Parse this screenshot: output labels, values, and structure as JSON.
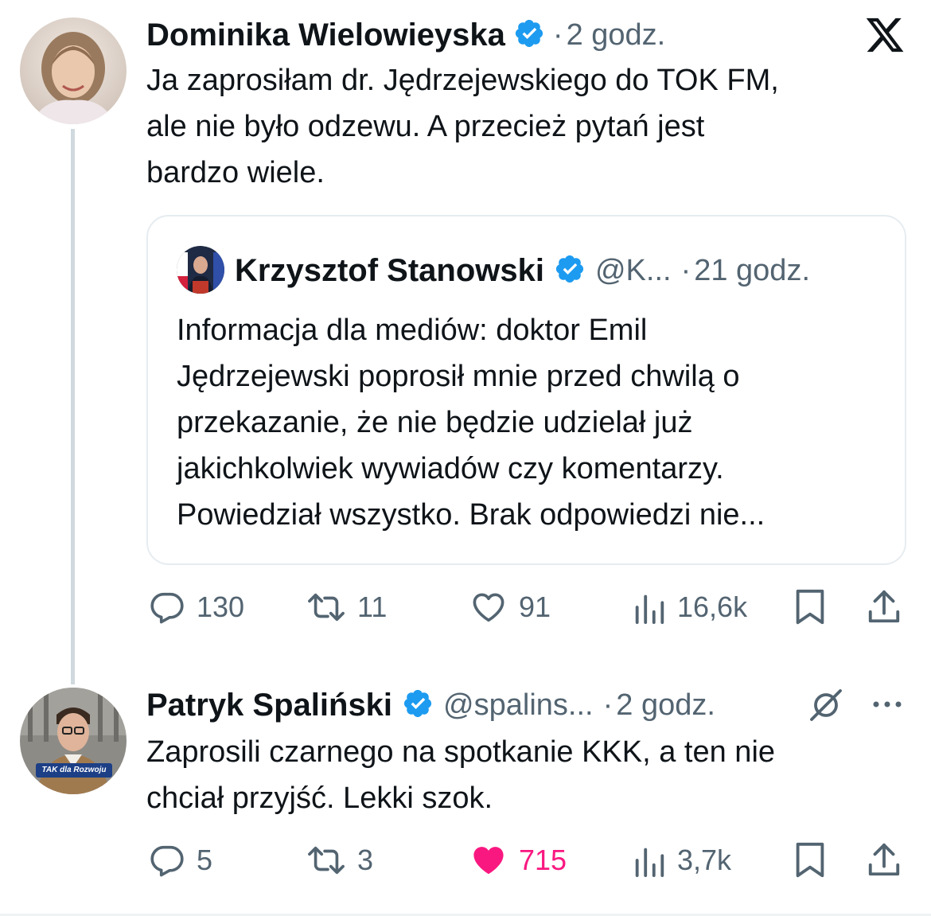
{
  "colors": {
    "text": "#0f1419",
    "secondary": "#536471",
    "verified": "#1d9bf0",
    "like_active": "#f91880",
    "border": "#e6ecf0"
  },
  "app_icon": "x-logo-icon",
  "tweet1": {
    "author": "Dominika Wielowieyska",
    "sep": "·",
    "time": "2 godz.",
    "text_lines": [
      "Ja zaprosiłam dr. Jędrzejewskiego do TOK FM,",
      "ale nie było odzewu. A przecież pytań jest",
      "bardzo wiele."
    ],
    "quote": {
      "author": "Krzysztof Stanowski",
      "handle": "@K...",
      "sep": "·",
      "time": "21 godz.",
      "text_lines": [
        "Informacja dla mediów: doktor Emil",
        "Jędrzejewski poprosił mnie przed chwilą o",
        "przekazanie, że nie będzie udzielał już",
        "jakichkolwiek wywiadów czy komentarzy.",
        "Powiedział wszystko. Brak odpowiedzi nie..."
      ]
    },
    "actions": {
      "replies": "130",
      "retweets": "11",
      "likes": "91",
      "views": "16,6k",
      "liked": false
    }
  },
  "tweet2": {
    "author": "Patryk Spaliński",
    "handle": "@spalins...",
    "sep": "·",
    "time": "2 godz.",
    "avatar_badge": "TAK dla Rozwoju",
    "text_lines": [
      "Zaprosili czarnego na spotkanie KKK, a ten nie",
      "chciał przyjść. Lekki szok."
    ],
    "actions": {
      "replies": "5",
      "retweets": "3",
      "likes": "715",
      "views": "3,7k",
      "liked": true
    }
  }
}
